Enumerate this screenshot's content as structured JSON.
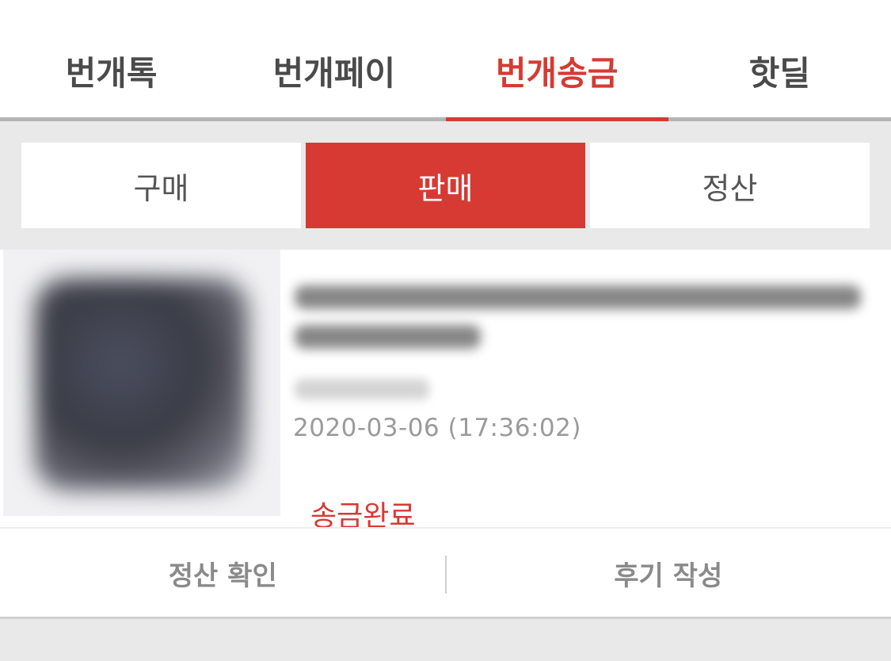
{
  "top_tabs": [
    {
      "label": "번개톡"
    },
    {
      "label": "번개페이"
    },
    {
      "label": "번개송금",
      "active": true
    },
    {
      "label": "핫딜"
    }
  ],
  "sub_tabs": [
    {
      "label": "구매"
    },
    {
      "label": "판매",
      "active": true
    },
    {
      "label": "정산"
    }
  ],
  "item": {
    "date": "2020-03-06 (17:36:02)",
    "status": "송금완료"
  },
  "actions": {
    "settlement_check": "정산 확인",
    "write_review": "후기 작성"
  },
  "colors": {
    "accent": "#d63a33",
    "tab_text": "#4a4a4a",
    "muted_text": "#9b9b9b",
    "background": "#e9e9e9"
  }
}
